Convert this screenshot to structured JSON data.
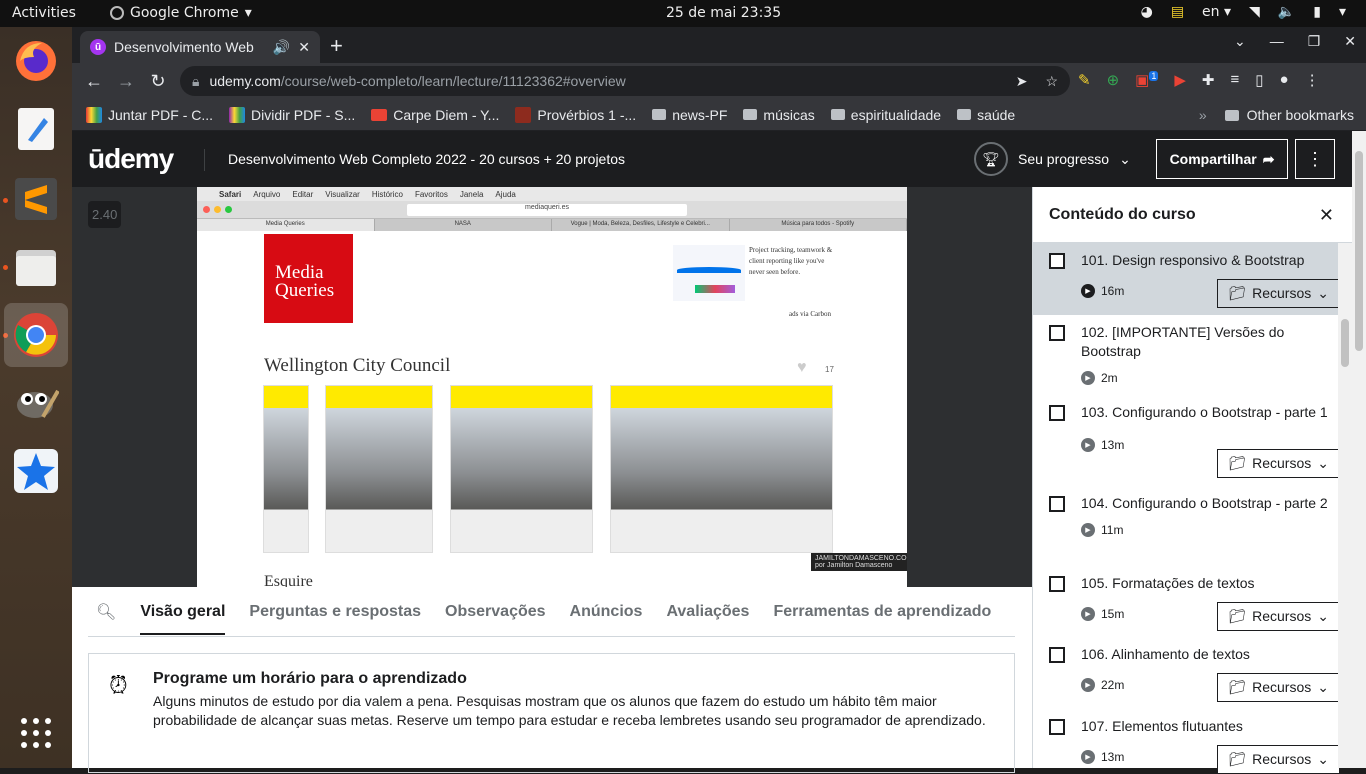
{
  "topbar": {
    "activities": "Activities",
    "app": "Google Chrome",
    "clock": "25 de mai  23:35",
    "lang": "en"
  },
  "chrome": {
    "tab_title": "Desenvolvimento Web",
    "url_host": "udemy.com",
    "url_path": "/course/web-completo/learn/lecture/11123362#overview",
    "ext_badge": "1",
    "bookmarks": [
      "Juntar PDF - C...",
      "Dividir PDF - S...",
      "Carpe Diem - Y...",
      "Provérbios 1 -...",
      "news-PF",
      "músicas",
      "espiritualidade",
      "saúde"
    ],
    "other_bookmarks": "Other bookmarks"
  },
  "header": {
    "logo": "ūdemy",
    "course_title": "Desenvolvimento Web Completo 2022 - 20 cursos + 20 projetos",
    "progress_label": "Seu progresso",
    "share_label": "Compartilhar"
  },
  "player": {
    "speed": "2.40",
    "mac_menu": [
      "Safari",
      "Arquivo",
      "Editar",
      "Visualizar",
      "Histórico",
      "Favoritos",
      "Janela",
      "Ajuda"
    ],
    "address": "mediaqueri.es",
    "mac_tabs": [
      "Media Queries",
      "NASA",
      "Vogue | Moda, Beleza, Desfiles, Lifestyle e Celebri...",
      "Música para todos - Spotify"
    ],
    "logo_line1": "Media",
    "logo_line2": "Queries",
    "ad_text": "Project tracking, teamwork & client reporting like you've never seen before.",
    "ad_credit": "ads via Carbon",
    "site_title": "Wellington City Council",
    "site_hearts": "17",
    "watermark": "JAMILTONDAMASCENO.COM por Jamilton Damasceno",
    "next_site": "Esquire"
  },
  "sidebar": {
    "title": "Conteúdo do curso",
    "resources_label": "Recursos",
    "lectures": [
      {
        "title": "101. Design responsivo & Bootstrap",
        "duration": "16m"
      },
      {
        "title": "102. [IMPORTANTE] Versões do Bootstrap",
        "duration": "2m"
      },
      {
        "title": "103. Configurando o Bootstrap - parte 1",
        "duration": "13m"
      },
      {
        "title": "104. Configurando o Bootstrap - parte 2",
        "duration": "11m"
      },
      {
        "title": "105. Formatações de textos",
        "duration": "15m"
      },
      {
        "title": "106. Alinhamento de textos",
        "duration": "22m"
      },
      {
        "title": "107. Elementos flutuantes",
        "duration": "13m"
      }
    ]
  },
  "lower_tabs": [
    "Visão geral",
    "Perguntas e respostas",
    "Observações",
    "Anúncios",
    "Avaliações",
    "Ferramentas de aprendizado"
  ],
  "schedule": {
    "title": "Programe um horário para o aprendizado",
    "text": "Alguns minutos de estudo por dia valem a pena. Pesquisas mostram que os alunos que fazem do estudo um hábito têm maior probabilidade de alcançar suas metas. Reserve um tempo para estudar e receba lembretes usando seu programador de aprendizado."
  }
}
